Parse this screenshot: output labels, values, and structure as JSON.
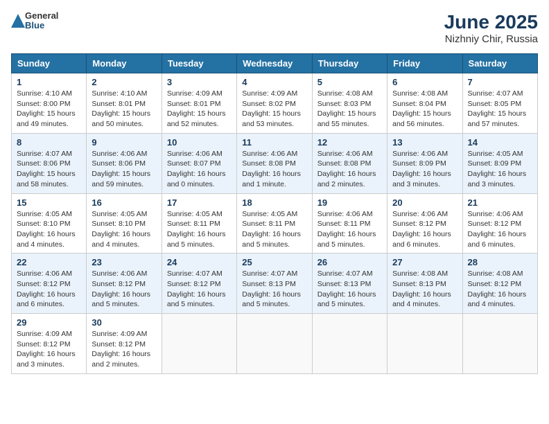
{
  "logo": {
    "general": "General",
    "blue": "Blue"
  },
  "title": "June 2025",
  "subtitle": "Nizhniy Chir, Russia",
  "days_of_week": [
    "Sunday",
    "Monday",
    "Tuesday",
    "Wednesday",
    "Thursday",
    "Friday",
    "Saturday"
  ],
  "weeks": [
    [
      {
        "day": 1,
        "info": "Sunrise: 4:10 AM\nSunset: 8:00 PM\nDaylight: 15 hours\nand 49 minutes."
      },
      {
        "day": 2,
        "info": "Sunrise: 4:10 AM\nSunset: 8:01 PM\nDaylight: 15 hours\nand 50 minutes."
      },
      {
        "day": 3,
        "info": "Sunrise: 4:09 AM\nSunset: 8:01 PM\nDaylight: 15 hours\nand 52 minutes."
      },
      {
        "day": 4,
        "info": "Sunrise: 4:09 AM\nSunset: 8:02 PM\nDaylight: 15 hours\nand 53 minutes."
      },
      {
        "day": 5,
        "info": "Sunrise: 4:08 AM\nSunset: 8:03 PM\nDaylight: 15 hours\nand 55 minutes."
      },
      {
        "day": 6,
        "info": "Sunrise: 4:08 AM\nSunset: 8:04 PM\nDaylight: 15 hours\nand 56 minutes."
      },
      {
        "day": 7,
        "info": "Sunrise: 4:07 AM\nSunset: 8:05 PM\nDaylight: 15 hours\nand 57 minutes."
      }
    ],
    [
      {
        "day": 8,
        "info": "Sunrise: 4:07 AM\nSunset: 8:06 PM\nDaylight: 15 hours\nand 58 minutes."
      },
      {
        "day": 9,
        "info": "Sunrise: 4:06 AM\nSunset: 8:06 PM\nDaylight: 15 hours\nand 59 minutes."
      },
      {
        "day": 10,
        "info": "Sunrise: 4:06 AM\nSunset: 8:07 PM\nDaylight: 16 hours\nand 0 minutes."
      },
      {
        "day": 11,
        "info": "Sunrise: 4:06 AM\nSunset: 8:08 PM\nDaylight: 16 hours\nand 1 minute."
      },
      {
        "day": 12,
        "info": "Sunrise: 4:06 AM\nSunset: 8:08 PM\nDaylight: 16 hours\nand 2 minutes."
      },
      {
        "day": 13,
        "info": "Sunrise: 4:06 AM\nSunset: 8:09 PM\nDaylight: 16 hours\nand 3 minutes."
      },
      {
        "day": 14,
        "info": "Sunrise: 4:05 AM\nSunset: 8:09 PM\nDaylight: 16 hours\nand 3 minutes."
      }
    ],
    [
      {
        "day": 15,
        "info": "Sunrise: 4:05 AM\nSunset: 8:10 PM\nDaylight: 16 hours\nand 4 minutes."
      },
      {
        "day": 16,
        "info": "Sunrise: 4:05 AM\nSunset: 8:10 PM\nDaylight: 16 hours\nand 4 minutes."
      },
      {
        "day": 17,
        "info": "Sunrise: 4:05 AM\nSunset: 8:11 PM\nDaylight: 16 hours\nand 5 minutes."
      },
      {
        "day": 18,
        "info": "Sunrise: 4:05 AM\nSunset: 8:11 PM\nDaylight: 16 hours\nand 5 minutes."
      },
      {
        "day": 19,
        "info": "Sunrise: 4:06 AM\nSunset: 8:11 PM\nDaylight: 16 hours\nand 5 minutes."
      },
      {
        "day": 20,
        "info": "Sunrise: 4:06 AM\nSunset: 8:12 PM\nDaylight: 16 hours\nand 6 minutes."
      },
      {
        "day": 21,
        "info": "Sunrise: 4:06 AM\nSunset: 8:12 PM\nDaylight: 16 hours\nand 6 minutes."
      }
    ],
    [
      {
        "day": 22,
        "info": "Sunrise: 4:06 AM\nSunset: 8:12 PM\nDaylight: 16 hours\nand 6 minutes."
      },
      {
        "day": 23,
        "info": "Sunrise: 4:06 AM\nSunset: 8:12 PM\nDaylight: 16 hours\nand 5 minutes."
      },
      {
        "day": 24,
        "info": "Sunrise: 4:07 AM\nSunset: 8:12 PM\nDaylight: 16 hours\nand 5 minutes."
      },
      {
        "day": 25,
        "info": "Sunrise: 4:07 AM\nSunset: 8:13 PM\nDaylight: 16 hours\nand 5 minutes."
      },
      {
        "day": 26,
        "info": "Sunrise: 4:07 AM\nSunset: 8:13 PM\nDaylight: 16 hours\nand 5 minutes."
      },
      {
        "day": 27,
        "info": "Sunrise: 4:08 AM\nSunset: 8:13 PM\nDaylight: 16 hours\nand 4 minutes."
      },
      {
        "day": 28,
        "info": "Sunrise: 4:08 AM\nSunset: 8:12 PM\nDaylight: 16 hours\nand 4 minutes."
      }
    ],
    [
      {
        "day": 29,
        "info": "Sunrise: 4:09 AM\nSunset: 8:12 PM\nDaylight: 16 hours\nand 3 minutes."
      },
      {
        "day": 30,
        "info": "Sunrise: 4:09 AM\nSunset: 8:12 PM\nDaylight: 16 hours\nand 2 minutes."
      },
      null,
      null,
      null,
      null,
      null
    ]
  ]
}
